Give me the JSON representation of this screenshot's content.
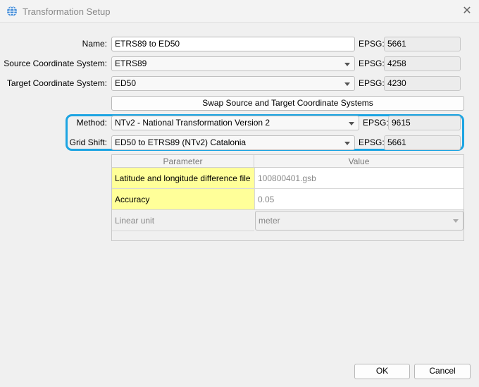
{
  "window": {
    "title": "Transformation Setup",
    "close": "✕"
  },
  "form": {
    "name": {
      "label": "Name:",
      "value": "ETRS89 to ED50",
      "epsg_label": "EPSG:",
      "epsg": "5661"
    },
    "source": {
      "label": "Source Coordinate System:",
      "value": "ETRS89",
      "epsg_label": "EPSG:",
      "epsg": "4258"
    },
    "target": {
      "label": "Target Coordinate System:",
      "value": "ED50",
      "epsg_label": "EPSG:",
      "epsg": "4230"
    },
    "swap_label": "Swap Source and Target Coordinate Systems",
    "method": {
      "label": "Method:",
      "value": "NTv2 - National Transformation Version 2",
      "epsg_label": "EPSG:",
      "epsg": "9615"
    },
    "grid_shift": {
      "label": "Grid Shift:",
      "value": "ED50 to ETRS89 (NTv2) Catalonia",
      "epsg_label": "EPSG:",
      "epsg": "5661"
    }
  },
  "table": {
    "headers": [
      "Parameter",
      "Value"
    ],
    "rows": [
      {
        "param": "Latitude and longitude difference file",
        "value": "100800401.gsb"
      },
      {
        "param": "Accuracy",
        "value": "0.05"
      },
      {
        "param": "Linear unit",
        "value": "meter"
      }
    ]
  },
  "buttons": {
    "ok": "OK",
    "cancel": "Cancel"
  },
  "colors": {
    "highlight": "#1ca4e2",
    "required": "#ffff99"
  }
}
